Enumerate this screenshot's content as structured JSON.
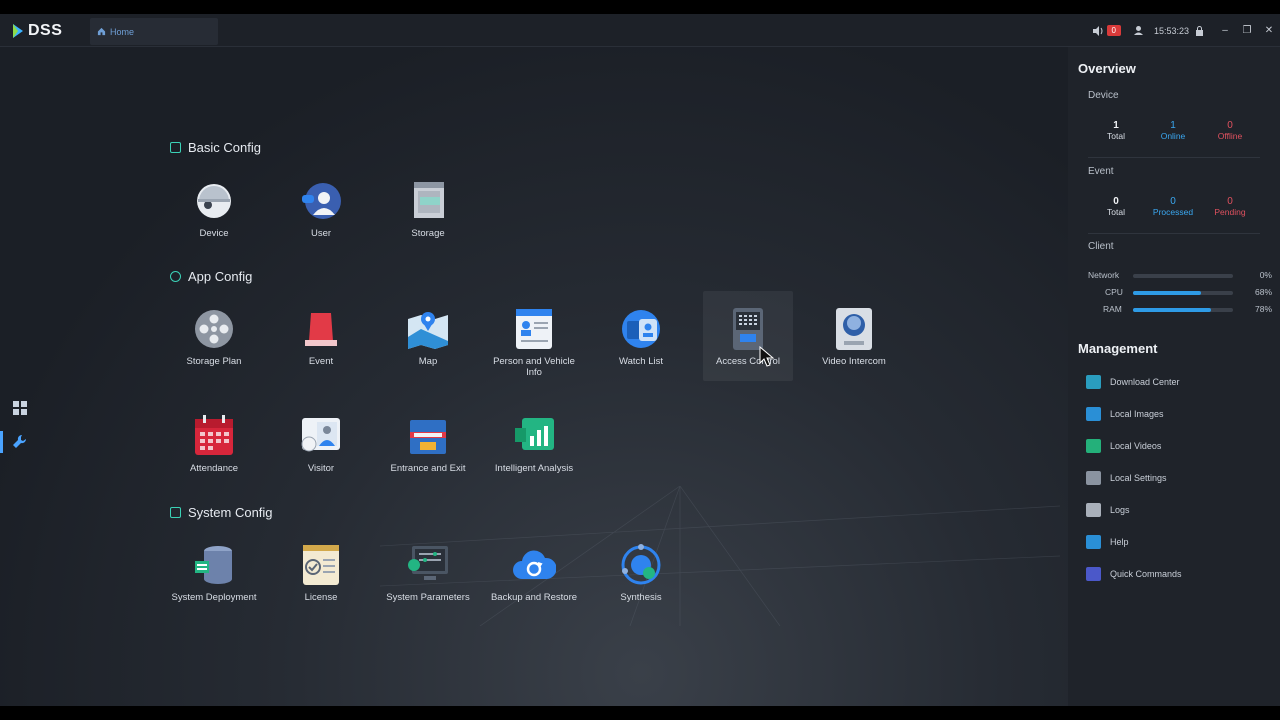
{
  "app": {
    "logo": "DSS"
  },
  "tabs": [
    {
      "label": "Home"
    }
  ],
  "topbar": {
    "alarm_count": "0",
    "time": "15:53:23"
  },
  "sections": {
    "basic": {
      "title": "Basic Config",
      "apps": [
        {
          "label": "Device"
        },
        {
          "label": "User"
        },
        {
          "label": "Storage"
        }
      ]
    },
    "appconfig": {
      "title": "App Config",
      "apps": [
        {
          "label": "Storage Plan"
        },
        {
          "label": "Event"
        },
        {
          "label": "Map"
        },
        {
          "label": "Person and Vehicle Info"
        },
        {
          "label": "Watch List"
        },
        {
          "label": "Access Control"
        },
        {
          "label": "Video Intercom"
        },
        {
          "label": "Attendance"
        },
        {
          "label": "Visitor"
        },
        {
          "label": "Entrance and Exit"
        },
        {
          "label": "Intelligent Analysis"
        }
      ]
    },
    "system": {
      "title": "System Config",
      "apps": [
        {
          "label": "System Deployment"
        },
        {
          "label": "License"
        },
        {
          "label": "System Parameters"
        },
        {
          "label": "Backup and Restore"
        },
        {
          "label": "Synthesis"
        }
      ]
    }
  },
  "overview": {
    "title": "Overview",
    "device": {
      "label": "Device",
      "total": {
        "value": "1",
        "label": "Total"
      },
      "online": {
        "value": "1",
        "label": "Online"
      },
      "offline": {
        "value": "0",
        "label": "Offline"
      }
    },
    "event": {
      "label": "Event",
      "total": {
        "value": "0",
        "label": "Total"
      },
      "processed": {
        "value": "0",
        "label": "Processed"
      },
      "pending": {
        "value": "0",
        "label": "Pending"
      }
    },
    "client": {
      "label": "Client",
      "network": {
        "label": "Network",
        "percent": "0%",
        "level": 0
      },
      "cpu": {
        "label": "CPU",
        "percent": "68%",
        "level": 68
      },
      "ram": {
        "label": "RAM",
        "percent": "78%",
        "level": 78
      }
    }
  },
  "management": {
    "title": "Management",
    "items": [
      {
        "label": "Download Center",
        "color": "#2a9dbf"
      },
      {
        "label": "Local Images",
        "color": "#2a8fd6"
      },
      {
        "label": "Local Videos",
        "color": "#24b07a"
      },
      {
        "label": "Local Settings",
        "color": "#8a93a0"
      },
      {
        "label": "Logs",
        "color": "#a9b0ba"
      },
      {
        "label": "Help",
        "color": "#2a8fd6"
      },
      {
        "label": "Quick Commands",
        "color": "#4b58c9"
      }
    ]
  },
  "colors": {
    "online": "#3aa7f0",
    "offline": "#e0515f",
    "accent": "#2e9be6"
  }
}
